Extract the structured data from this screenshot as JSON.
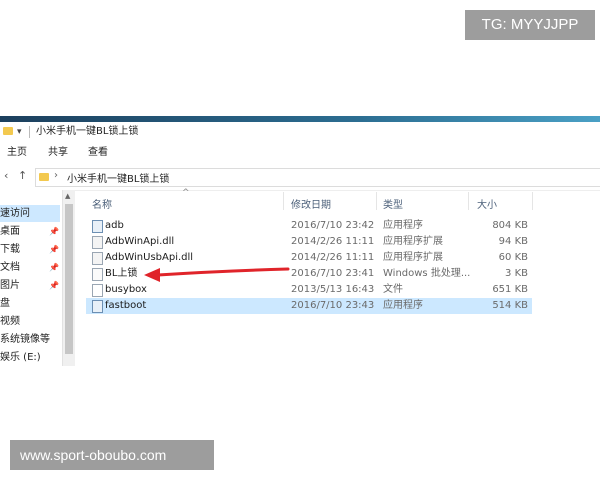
{
  "watermarks": {
    "top": "TG: MYYJJPP",
    "bottom": "www.sport-oboubo.com"
  },
  "window": {
    "title": "小米手机一键BL锁上锁",
    "quick_access_glyph": "▾",
    "accent_color": "#2c6e92"
  },
  "ribbon": {
    "tabs": [
      "主页",
      "共享",
      "查看"
    ]
  },
  "address": {
    "back_glyph": "‹",
    "up_glyph": "↑",
    "chevron": "›",
    "path": "小米手机一键BL锁上锁"
  },
  "nav_pane": {
    "items": [
      {
        "label": "速访问",
        "pinned": false,
        "selected": true
      },
      {
        "label": "桌面",
        "pinned": true,
        "selected": false
      },
      {
        "label": "下载",
        "pinned": true,
        "selected": false
      },
      {
        "label": "文档",
        "pinned": true,
        "selected": false
      },
      {
        "label": "图片",
        "pinned": true,
        "selected": false
      },
      {
        "label": "盘",
        "pinned": false,
        "selected": false
      },
      {
        "label": "视频",
        "pinned": false,
        "selected": false
      },
      {
        "label": "系统镜像等",
        "pinned": false,
        "selected": false
      },
      {
        "label": "娱乐 (E:)",
        "pinned": false,
        "selected": false
      }
    ],
    "pin_glyph": "📌"
  },
  "columns": {
    "name": "名称",
    "date": "修改日期",
    "type": "类型",
    "size": "大小",
    "sort_glyph": "^"
  },
  "files": [
    {
      "name": "adb",
      "date": "2016/7/10 23:42",
      "type": "应用程序",
      "size": "804 KB",
      "icon": "exe-icon",
      "selected": false
    },
    {
      "name": "AdbWinApi.dll",
      "date": "2014/2/26 11:11",
      "type": "应用程序扩展",
      "size": "94 KB",
      "icon": "dll-icon",
      "selected": false
    },
    {
      "name": "AdbWinUsbApi.dll",
      "date": "2014/2/26 11:11",
      "type": "应用程序扩展",
      "size": "60 KB",
      "icon": "dll-icon",
      "selected": false
    },
    {
      "name": "BL上锁",
      "date": "2016/7/10 23:41",
      "type": "Windows 批处理...",
      "size": "3 KB",
      "icon": "bat-icon",
      "selected": false
    },
    {
      "name": "busybox",
      "date": "2013/5/13 16:43",
      "type": "文件",
      "size": "651 KB",
      "icon": "file-icon",
      "selected": false
    },
    {
      "name": "fastboot",
      "date": "2016/7/10 23:43",
      "type": "应用程序",
      "size": "514 KB",
      "icon": "exe-icon",
      "selected": true
    }
  ],
  "annotation": {
    "arrow_color": "#e0242a"
  }
}
